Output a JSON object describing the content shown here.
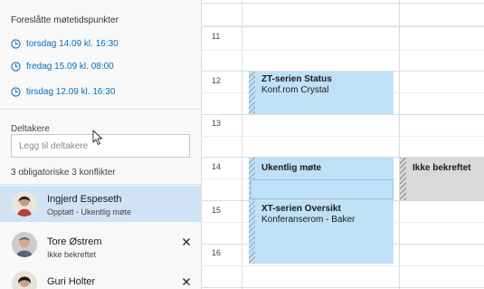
{
  "suggestions": {
    "title": "Foreslåtte møtetidspunkter",
    "slots": [
      "torsdag 14.09 kl. 16:30",
      "fredag 15.09 kl. 08:00",
      "tirsdag 12.09 kl. 16:30"
    ]
  },
  "attendees": {
    "title": "Deltakere",
    "placeholder": "Legg til deltakere",
    "conflicts_summary": "3 obligatoriske 3 konflikter",
    "people": [
      {
        "name": "Ingjerd Espeseth",
        "status": "Opptatt - Ukentlig møte",
        "selected": true
      },
      {
        "name": "Tore Østrem",
        "status": "Ikke bekreftet"
      },
      {
        "name": "Guri Holter",
        "status": ""
      }
    ]
  },
  "calendar": {
    "hours": [
      "11",
      "12",
      "13",
      "14",
      "15",
      "16"
    ],
    "events": [
      {
        "title": "ZT-serien Status",
        "location": "Konf.rom Crystal"
      },
      {
        "title": "Ukentlig møte",
        "location": ""
      },
      {
        "title": "Ikke bekreftet",
        "location": ""
      },
      {
        "title": "XT-serien Oversikt",
        "location": "Konferanserom - Baker"
      }
    ]
  },
  "colors": {
    "accent": "#0a6ebd",
    "event_fill": "#bfe1f7",
    "tentative_fill": "#d9d9d9",
    "selected_row": "#cfe3f5"
  }
}
